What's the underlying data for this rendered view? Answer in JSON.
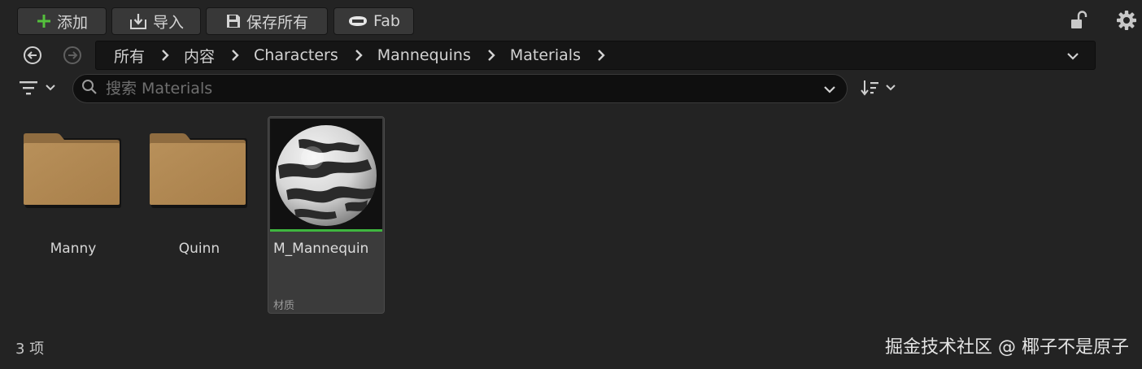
{
  "toolbar": {
    "add_label": "添加",
    "import_label": "导入",
    "save_all_label": "保存所有",
    "fab_label": "Fab"
  },
  "colors": {
    "accent_green": "#3fb640",
    "folder": "#b38a55",
    "background": "#232323"
  },
  "breadcrumb": {
    "items": [
      "所有",
      "内容",
      "Characters",
      "Mannequins",
      "Materials"
    ]
  },
  "search": {
    "placeholder": "搜索 Materials",
    "value": ""
  },
  "assets": {
    "folders": [
      {
        "name": "Manny"
      },
      {
        "name": "Quinn"
      }
    ],
    "material": {
      "name": "M_Mannequin",
      "type": "材质"
    }
  },
  "status": {
    "item_count": "3 项"
  },
  "watermark": "掘金技术社区 @ 椰子不是原子",
  "icons": [
    "plus-icon",
    "import-icon",
    "save-icon",
    "fab-icon",
    "lock-icon",
    "settings-icon",
    "back-icon",
    "forward-icon",
    "chevron-right-icon",
    "chevron-down-icon",
    "filter-icon",
    "search-icon",
    "sort-icon",
    "folder-icon"
  ]
}
